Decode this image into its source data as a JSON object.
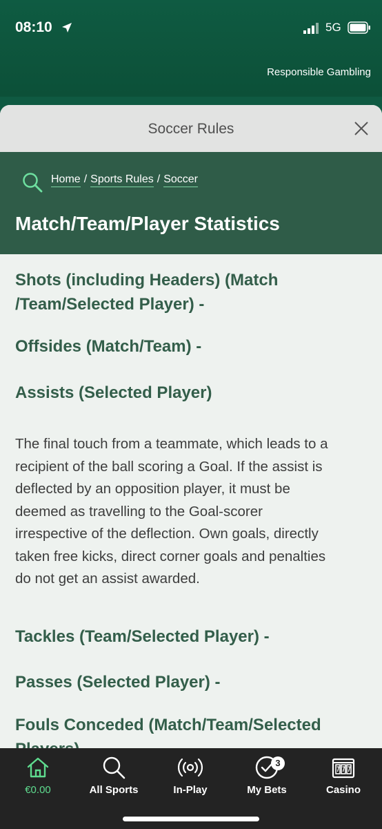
{
  "status_bar": {
    "time": "08:10",
    "network": "5G"
  },
  "banner": {
    "responsible_link": "Responsible Gambling"
  },
  "sheet": {
    "title": "Soccer Rules"
  },
  "breadcrumb": {
    "home": "Home",
    "sep1": "/",
    "sports_rules": "Sports Rules",
    "sep2": "/",
    "soccer": "Soccer"
  },
  "page": {
    "title": "Match/Team/Player Statistics"
  },
  "content": {
    "shots_l1": "Shots (including Headers) (Match",
    "shots_l2": "/Team/Selected Player) -",
    "offsides": "Offsides (Match/Team) -",
    "assists": "Assists (Selected Player)",
    "assists_desc": [
      "The final touch from a teammate, which leads to a",
      "recipient of the ball scoring a Goal. If the assist is",
      "deflected by an opposition player, it must be",
      "deemed as travelling to the Goal-scorer",
      "irrespective of the deflection. Own goals, directly",
      "taken free kicks, direct corner goals and penalties",
      "do not get an assist awarded."
    ],
    "tackles": "Tackles (Team/Selected Player) -",
    "passes": "Passes (Selected Player) -",
    "fouls_l1": "Fouls Conceded (Match/Team/Selected",
    "fouls_l2": "Players)"
  },
  "bottom_nav": [
    {
      "label": "€0.00",
      "icon": "home-icon",
      "active": true
    },
    {
      "label": "All Sports",
      "icon": "search-icon"
    },
    {
      "label": "In-Play",
      "icon": "broadcast-icon"
    },
    {
      "label": "My Bets",
      "icon": "check-circle-icon",
      "badge": "3"
    },
    {
      "label": "Casino",
      "icon": "slot-machine-icon"
    }
  ],
  "colors": {
    "brand_green": "#0f5a42",
    "hero": "#2f5c48",
    "accent": "#5fdc8f",
    "heading": "#335e4a"
  }
}
